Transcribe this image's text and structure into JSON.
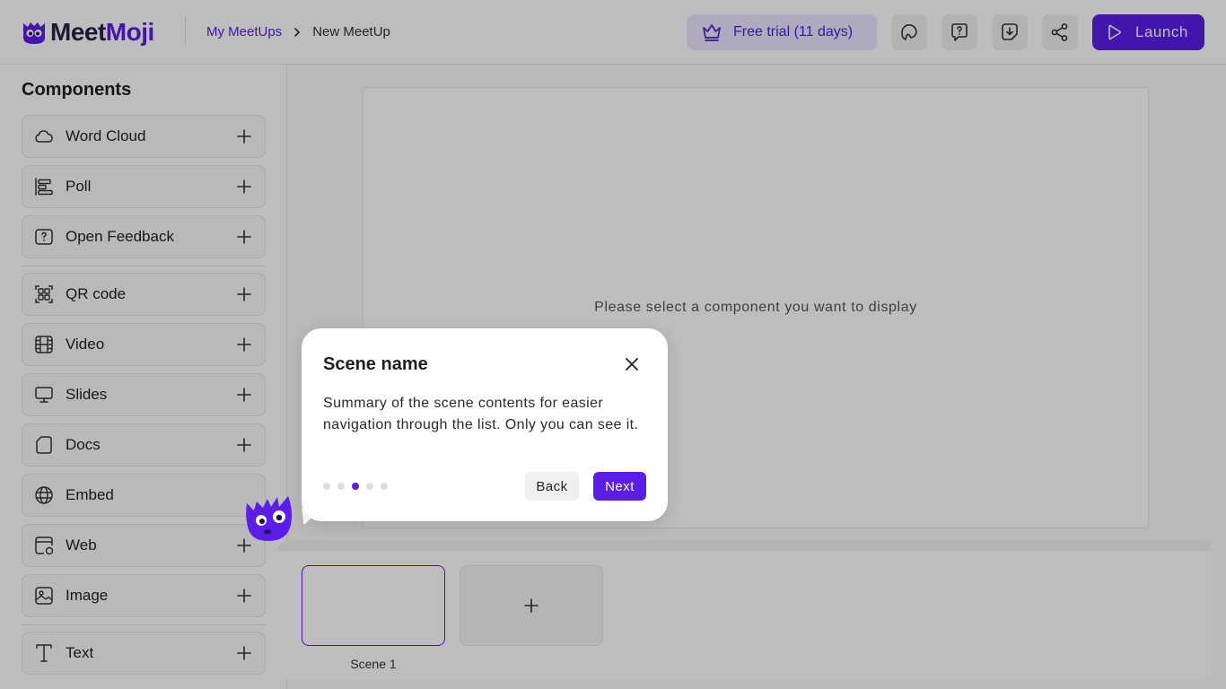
{
  "app": {
    "name_part1": "Meet",
    "name_part2": "Moji",
    "brand_color": "#5a1ee8"
  },
  "breadcrumb": {
    "parent": "My MeetUps",
    "current": "New MeetUp"
  },
  "header": {
    "trial_label": "Free trial (11 days)",
    "launch_label": "Launch",
    "icon_buttons": [
      "chat-bubble-icon",
      "help-bubble-icon",
      "download-icon",
      "share-icon"
    ]
  },
  "sidebar": {
    "title": "Components",
    "items": [
      {
        "label": "Word Cloud",
        "icon": "cloud-icon",
        "addable": true
      },
      {
        "label": "Poll",
        "icon": "poll-bars-icon",
        "addable": true
      },
      {
        "label": "Open Feedback",
        "icon": "question-box-icon",
        "addable": true
      },
      {
        "label": "QR code",
        "icon": "qr-code-icon",
        "addable": true
      },
      {
        "label": "Video",
        "icon": "film-icon",
        "addable": true
      },
      {
        "label": "Slides",
        "icon": "monitor-icon",
        "addable": true
      },
      {
        "label": "Docs",
        "icon": "document-icon",
        "addable": true
      },
      {
        "label": "Embed",
        "icon": "globe-icon",
        "addable": false
      },
      {
        "label": "Web",
        "icon": "web-page-icon",
        "addable": true
      },
      {
        "label": "Image",
        "icon": "image-icon",
        "addable": true
      },
      {
        "label": "Text",
        "icon": "text-t-icon",
        "addable": true
      }
    ]
  },
  "canvas": {
    "placeholder": "Please select a component you want to display"
  },
  "scenes": {
    "items": [
      {
        "label": "Scene 1",
        "selected": true
      }
    ]
  },
  "tour": {
    "title": "Scene name",
    "body": "Summary of the scene contents for easier navigation through the list. Only you can see it.",
    "step_current": 3,
    "step_total": 5,
    "back_label": "Back",
    "next_label": "Next"
  }
}
